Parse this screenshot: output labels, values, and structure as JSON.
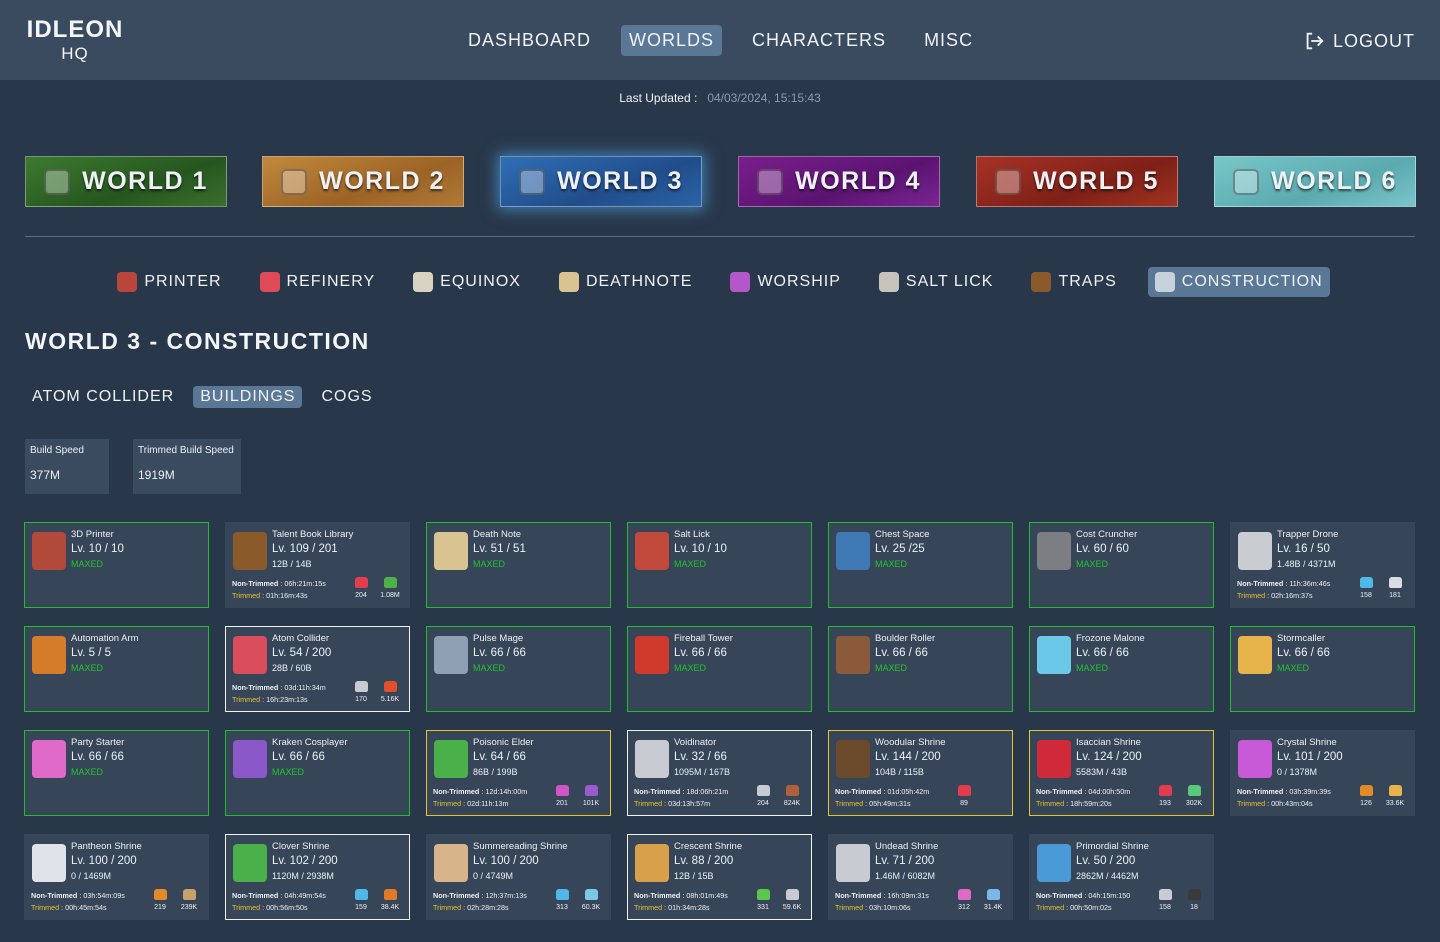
{
  "app": {
    "logo_line1": "IDLEON",
    "logo_line2": "HQ"
  },
  "nav": [
    "DASHBOARD",
    "WORLDS",
    "CHARACTERS",
    "MISC"
  ],
  "nav_active": "WORLDS",
  "logout_label": "LOGOUT",
  "last_updated": {
    "label": "Last Updated :",
    "value": "04/03/2024, 15:15:43"
  },
  "worlds": [
    "WORLD 1",
    "WORLD 2",
    "WORLD 3",
    "WORLD 4",
    "WORLD 5",
    "WORLD 6"
  ],
  "world_active": "WORLD 3",
  "subnav": [
    {
      "label": "PRINTER",
      "icon": "printer-icon",
      "color": "#b8463a"
    },
    {
      "label": "REFINERY",
      "icon": "refinery-icon",
      "color": "#e04a56"
    },
    {
      "label": "EQUINOX",
      "icon": "equinox-icon",
      "color": "#d8d2c2"
    },
    {
      "label": "DEATHNOTE",
      "icon": "deathnote-icon",
      "color": "#d9c390"
    },
    {
      "label": "WORSHIP",
      "icon": "worship-icon",
      "color": "#b457c9"
    },
    {
      "label": "SALT LICK",
      "icon": "salt-lick-icon",
      "color": "#c7c3bc"
    },
    {
      "label": "TRAPS",
      "icon": "traps-icon",
      "color": "#8a5a2a"
    },
    {
      "label": "CONSTRUCTION",
      "icon": "construction-icon",
      "color": "#c8d2dc"
    }
  ],
  "subnav_active": "CONSTRUCTION",
  "page_title": "WORLD 3 - CONSTRUCTION",
  "tabs": [
    "ATOM COLLIDER",
    "BUILDINGS",
    "COGS"
  ],
  "tab_active": "BUILDINGS",
  "stats": [
    {
      "label": "Build Speed",
      "value": "377M"
    },
    {
      "label": "Trimmed Build Speed",
      "value": "1919M"
    }
  ],
  "labels": {
    "non_trimmed": "Non-Trimmed",
    "trimmed": "Trimmed"
  },
  "buildings": [
    {
      "name": "3D Printer",
      "level": "Lv. 10 / 10",
      "status": "MAXED",
      "border": "green",
      "icon_color": "#b14a3a"
    },
    {
      "name": "Talent Book Library",
      "level": "Lv. 109 / 201",
      "progress": "12B / 14B",
      "border": "none",
      "icon_color": "#8b5a2b",
      "non_trimmed": "06h:21m:15s",
      "trimmed": "01h:16m:43s",
      "mat1": {
        "color": "#e23c4e",
        "value": "204"
      },
      "mat2": {
        "color": "#4fb04a",
        "value": "1.08M"
      }
    },
    {
      "name": "Death Note",
      "level": "Lv. 51 / 51",
      "status": "MAXED",
      "border": "green",
      "icon_color": "#d9c390"
    },
    {
      "name": "Salt Lick",
      "level": "Lv. 10 / 10",
      "status": "MAXED",
      "border": "green",
      "icon_color": "#c24a3c"
    },
    {
      "name": "Chest Space",
      "level": "Lv. 25 /25",
      "status": "MAXED",
      "border": "green",
      "icon_color": "#3f79b5"
    },
    {
      "name": "Cost Cruncher",
      "level": "Lv. 60 / 60",
      "status": "MAXED",
      "border": "green",
      "icon_color": "#7d7d84"
    },
    {
      "name": "Trapper Drone",
      "level": "Lv. 16 / 50",
      "progress": "1.48B / 4371M",
      "border": "none",
      "icon_color": "#c9cdd2",
      "non_trimmed": "11h:36m:46s",
      "trimmed": "02h:16m:37s",
      "mat1": {
        "color": "#4fb8e8",
        "value": "158"
      },
      "mat2": {
        "color": "#d8dde2",
        "value": "181"
      }
    },
    {
      "name": "Automation Arm",
      "level": "Lv. 5 / 5",
      "status": "MAXED",
      "border": "green",
      "icon_color": "#d47c2a"
    },
    {
      "name": "Atom Collider",
      "level": "Lv. 54 / 200",
      "progress": "28B / 60B",
      "border": "white",
      "icon_color": "#d94c5c",
      "non_trimmed": "03d:11h:34m",
      "trimmed": "16h:23m:13s",
      "mat1": {
        "color": "#c8ccd2",
        "value": "170"
      },
      "mat2": {
        "color": "#e0502c",
        "value": "5.16K"
      }
    },
    {
      "name": "Pulse Mage",
      "level": "Lv. 66 / 66",
      "status": "MAXED",
      "border": "green",
      "icon_color": "#8fa0b5"
    },
    {
      "name": "Fireball Tower",
      "level": "Lv. 66 / 66",
      "status": "MAXED",
      "border": "green",
      "icon_color": "#d03a2c"
    },
    {
      "name": "Boulder Roller",
      "level": "Lv. 66 / 66",
      "status": "MAXED",
      "border": "green",
      "icon_color": "#8a5a3a"
    },
    {
      "name": "Frozone Malone",
      "level": "Lv. 66 / 66",
      "status": "MAXED",
      "border": "green",
      "icon_color": "#6cc8e8"
    },
    {
      "name": "Stormcaller",
      "level": "Lv. 66 / 66",
      "status": "MAXED",
      "border": "green",
      "icon_color": "#e6b44a"
    },
    {
      "name": "Party Starter",
      "level": "Lv. 66 / 66",
      "status": "MAXED",
      "border": "green",
      "icon_color": "#e06ac8"
    },
    {
      "name": "Kraken Cosplayer",
      "level": "Lv. 66 / 66",
      "status": "MAXED",
      "border": "green",
      "icon_color": "#8a58c8"
    },
    {
      "name": "Poisonic Elder",
      "level": "Lv. 64 / 66",
      "progress": "86B / 199B",
      "border": "gold",
      "icon_color": "#4ab04a",
      "non_trimmed": "12d:14h:00m",
      "trimmed": "02d:11h:13m",
      "mat1": {
        "color": "#d056c8",
        "value": "201"
      },
      "mat2": {
        "color": "#9a5ad0",
        "value": "101K"
      }
    },
    {
      "name": "Voidinator",
      "level": "Lv. 32 / 66",
      "progress": "1095M / 167B",
      "border": "white",
      "icon_color": "#c8ccd2",
      "non_trimmed": "18d:06h:21m",
      "trimmed": "03d:13h:57m",
      "mat1": {
        "color": "#c8ccd2",
        "value": "204"
      },
      "mat2": {
        "color": "#b0603a",
        "value": "824K"
      }
    },
    {
      "name": "Woodular Shrine",
      "level": "Lv. 144 / 200",
      "progress": "104B / 115B",
      "border": "gold",
      "icon_color": "#6a4a2a",
      "non_trimmed": "01d:05h:42m",
      "trimmed": "05h:49m:31s",
      "mat1": {
        "color": "#e23c4e",
        "value": "89"
      }
    },
    {
      "name": "Isaccian Shrine",
      "level": "Lv. 124 / 200",
      "progress": "5583M / 43B",
      "border": "gold",
      "icon_color": "#d02a3a",
      "non_trimmed": "04d:00h:50m",
      "trimmed": "18h:59m:20s",
      "mat1": {
        "color": "#e23c4e",
        "value": "193"
      },
      "mat2": {
        "color": "#5ac87a",
        "value": "302K"
      }
    },
    {
      "name": "Crystal Shrine",
      "level": "Lv. 101 / 200",
      "progress": "0 / 1378M",
      "border": "none",
      "icon_color": "#c85ad8",
      "non_trimmed": "03h:39m:39s",
      "trimmed": "00h:43m:04s",
      "mat1": {
        "color": "#e08a2a",
        "value": "126"
      },
      "mat2": {
        "color": "#e6b44a",
        "value": "33.6K"
      }
    },
    {
      "name": "Pantheon Shrine",
      "level": "Lv. 100 / 200",
      "progress": "0 / 1469M",
      "border": "none",
      "icon_color": "#e0e4ea",
      "non_trimmed": "03h:54m:09s",
      "trimmed": "00h:45m:54s",
      "mat1": {
        "color": "#e08a2a",
        "value": "219"
      },
      "mat2": {
        "color": "#c8a06a",
        "value": "239K"
      }
    },
    {
      "name": "Clover Shrine",
      "level": "Lv. 102 / 200",
      "progress": "1120M / 2938M",
      "border": "white",
      "icon_color": "#4ab04a",
      "non_trimmed": "04h:49m:54s",
      "trimmed": "00h:56m:50s",
      "mat1": {
        "color": "#4fb8e8",
        "value": "159"
      },
      "mat2": {
        "color": "#e07a2a",
        "value": "38.4K"
      }
    },
    {
      "name": "Summereading Shrine",
      "level": "Lv. 100 / 200",
      "progress": "0 / 4749M",
      "border": "none",
      "icon_color": "#d8b48a",
      "non_trimmed": "12h:37m:13s",
      "trimmed": "02h:28m:28s",
      "mat1": {
        "color": "#4fb8e8",
        "value": "313"
      },
      "mat2": {
        "color": "#7ac8e8",
        "value": "60.3K"
      }
    },
    {
      "name": "Crescent Shrine",
      "level": "Lv. 88 / 200",
      "progress": "12B / 15B",
      "border": "white",
      "icon_color": "#d8a04a",
      "non_trimmed": "08h:01m:49s",
      "trimmed": "01h:34m:28s",
      "mat1": {
        "color": "#5ac84a",
        "value": "331"
      },
      "mat2": {
        "color": "#c8ccd2",
        "value": "59.6K"
      }
    },
    {
      "name": "Undead Shrine",
      "level": "Lv. 71 / 200",
      "progress": "1.46M / 6082M",
      "border": "none",
      "icon_color": "#c8ccd2",
      "non_trimmed": "16h:09m:31s",
      "trimmed": "03h:10m:06s",
      "mat1": {
        "color": "#e06ac8",
        "value": "312"
      },
      "mat2": {
        "color": "#7ab8e8",
        "value": "31.4K"
      }
    },
    {
      "name": "Primordial Shrine",
      "level": "Lv. 50 / 200",
      "progress": "2862M / 4462M",
      "border": "none",
      "icon_color": "#4a9ad8",
      "non_trimmed": "04h:15m:150",
      "trimmed": "00h:50m:02s",
      "mat1": {
        "color": "#c8ccd2",
        "value": "158"
      },
      "mat2": {
        "color": "#3a3a3a",
        "value": "18"
      }
    }
  ]
}
